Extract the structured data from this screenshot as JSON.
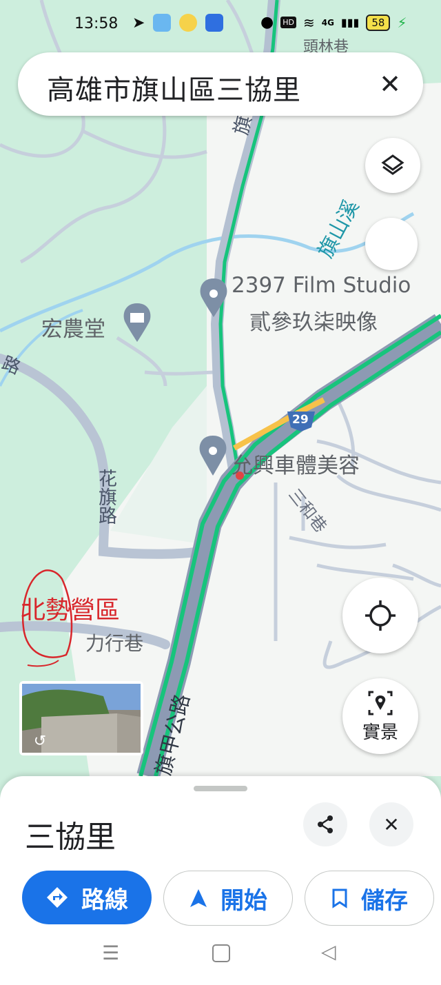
{
  "status_bar": {
    "time": "13:58",
    "network": "4G",
    "hd": "HD",
    "battery": "58"
  },
  "search": {
    "query": "高雄市旗山區三協里"
  },
  "map": {
    "road_labels": [
      "頭林巷",
      "旗南一路",
      "旗山溪",
      "旗甲公路",
      "花旗路",
      "三和巷",
      "力行巷",
      "路"
    ],
    "route_shield": "29",
    "pois": [
      {
        "name": "2397 Film Studio",
        "subname": "貳參玖柒映像"
      },
      {
        "name": "宏農堂"
      },
      {
        "name": "允興車體美容"
      }
    ],
    "annotation": "北勢營區"
  },
  "controls": {
    "street_view_label": "實景"
  },
  "sheet": {
    "title": "三協里",
    "actions": [
      {
        "label": "路線"
      },
      {
        "label": "開始"
      },
      {
        "label": "儲存"
      }
    ]
  },
  "colors": {
    "map_green": "#cdeedd",
    "road_gray": "#a6b2c6",
    "traffic_green": "#17c47c",
    "highway_yellow": "#f7c24a",
    "primary_blue": "#1a73e8",
    "annotation_red": "#d8262b"
  }
}
